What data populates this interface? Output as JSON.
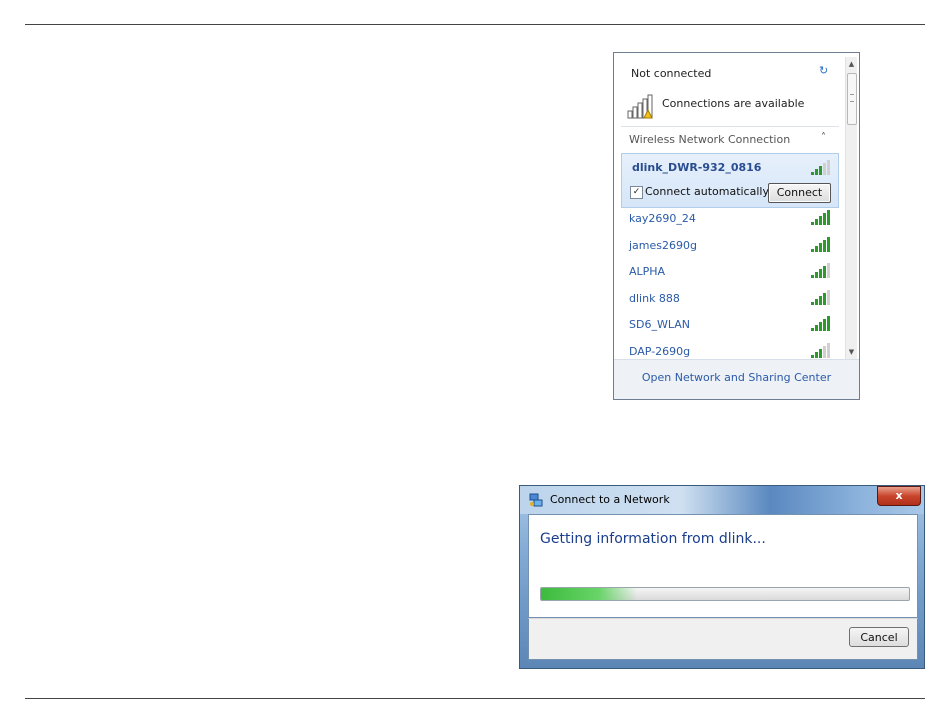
{
  "flyout": {
    "status": "Not connected",
    "availability": "Connections are available",
    "section_label": "Wireless Network Connection",
    "selected_network": {
      "name": "dlink_DWR-932_0816",
      "signal_level": 3,
      "connect_automatically_label": "Connect automatically",
      "connect_automatically_checked": true,
      "connect_button_label": "Connect"
    },
    "networks": [
      {
        "name": "kay2690_24",
        "signal_level": 5
      },
      {
        "name": "james2690g",
        "signal_level": 5
      },
      {
        "name": "ALPHA",
        "signal_level": 4
      },
      {
        "name": "dlink 888",
        "signal_level": 4
      },
      {
        "name": "SD6_WLAN",
        "signal_level": 5
      },
      {
        "name": "DAP-2690g",
        "signal_level": 3
      }
    ],
    "footer_link": "Open Network and Sharing Center",
    "icons": [
      "refresh-icon",
      "signal-warning-icon",
      "collapse-chevron-icon",
      "scroll-up-icon",
      "scroll-down-icon"
    ]
  },
  "dialog": {
    "title": "Connect to a Network",
    "close_label": "x",
    "message": "Getting information from dlink...",
    "progress_fraction": 0.26,
    "cancel_label": "Cancel",
    "accent_color": "#3dbb3d"
  }
}
